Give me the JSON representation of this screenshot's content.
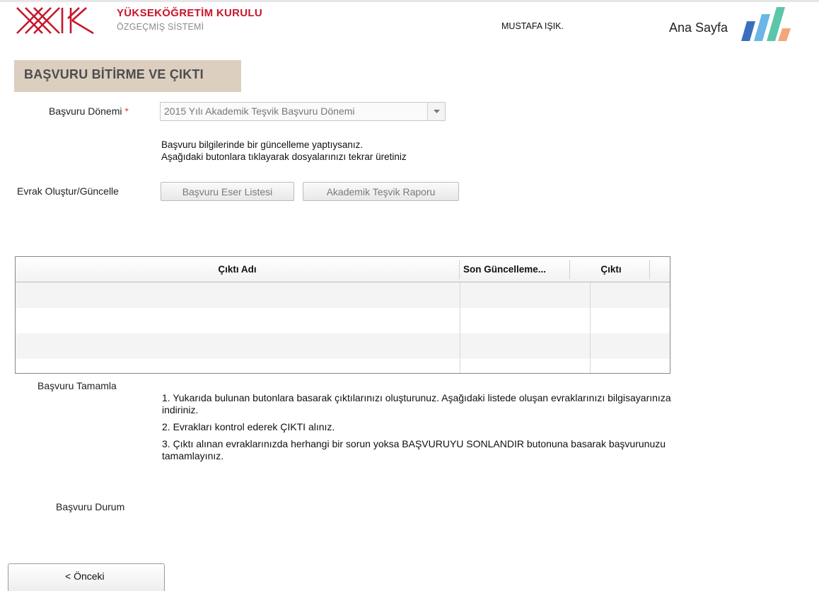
{
  "header": {
    "org_title": "YÜKSEKÖĞRETİM KURULU",
    "org_subtitle": "ÖZGEÇMİŞ SİSTEMİ",
    "user_name": "MUSTAFA IŞIK.",
    "home_link": "Ana Sayfa",
    "brand_colors": [
      "#3a6fc0",
      "#6ab6e6",
      "#5cc6a8",
      "#f2a77a"
    ]
  },
  "section": {
    "title": "BAŞVURU BİTİRME VE ÇIKTI"
  },
  "form": {
    "period_label": "Başvuru Dönemi",
    "required_mark": "*",
    "period_value": "2015 Yılı Akademik Teşvik Başvuru Dönemi",
    "info_line1": "Başvuru bilgilerinde bir güncelleme yaptıysanız.",
    "info_line2": "Aşağıdaki butonlara tıklayarak dosyalarınızı tekrar üretiniz",
    "docs_label": "Evrak Oluştur/Güncelle",
    "btn_eser_listesi": "Başvuru Eser Listesi",
    "btn_tesvik_raporu": "Akademik Teşvik Raporu"
  },
  "grid": {
    "columns": [
      "Çıktı Adı",
      "Son Güncelleme...",
      "Çıktı"
    ],
    "rows": []
  },
  "complete": {
    "label": "Başvuru Tamamla",
    "steps": [
      "1. Yukarıda bulunan butonlara basarak çıktılarınızı oluşturunuz. Aşağıdaki listede oluşan evraklarınızı bilgisayarınıza indiriniz.",
      "2. Evrakları kontrol ederek ÇIKTI alınız.",
      "3. Çıktı alınan evraklarınızda herhangi bir sorun yoksa BAŞVURUYU SONLANDIR butonuna basarak başvurunuzu tamamlayınız."
    ]
  },
  "status": {
    "label": "Başvuru Durum"
  },
  "nav": {
    "prev_label": "< Önceki"
  }
}
